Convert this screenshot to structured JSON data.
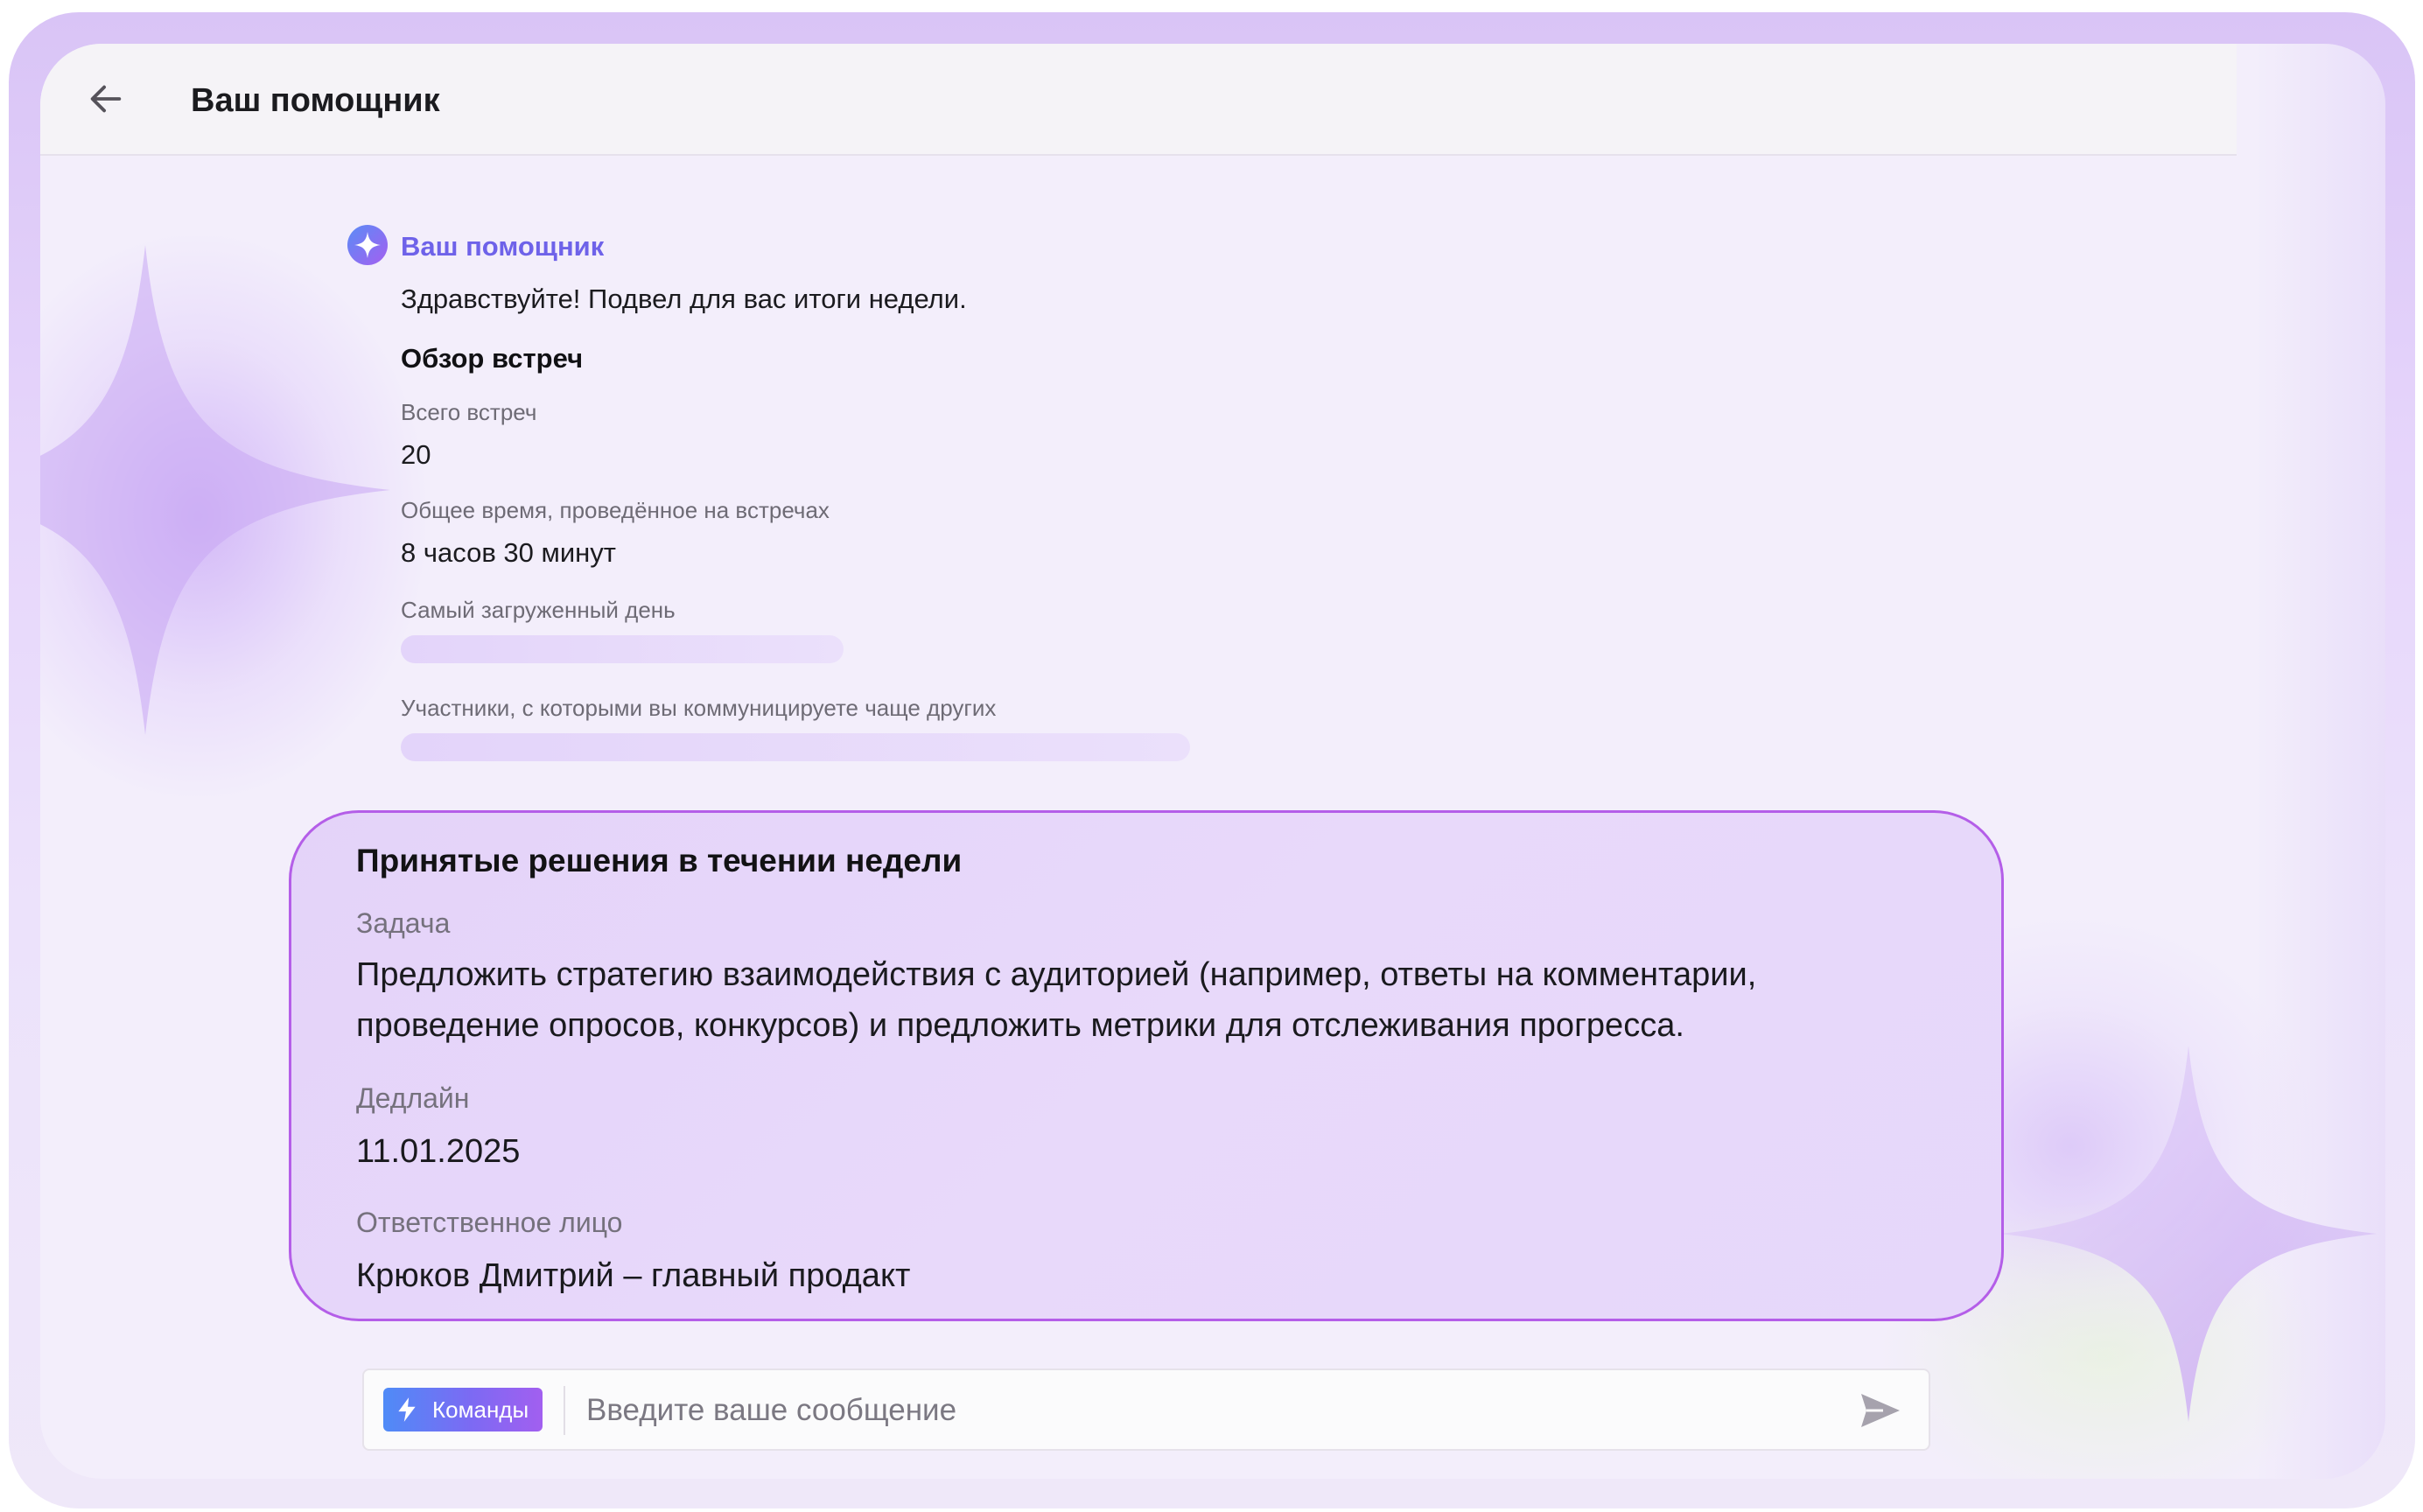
{
  "header": {
    "title": "Ваш помощник",
    "back_icon": "arrow-left-icon"
  },
  "assistant": {
    "icon": "sparkle-icon",
    "name": "Ваш помощник",
    "greeting": "Здравствуйте! Подвел для вас итоги недели.",
    "overview_title": "Обзор встреч",
    "total_meetings_label": "Всего встреч",
    "total_meetings_value": "20",
    "total_time_label": "Общее время, проведённое на встречах",
    "total_time_value": "8 часов 30 минут",
    "busiest_day_label": "Самый загруженный день",
    "frequent_participants_label": "Участники, с которыми вы коммуницируете чаще других"
  },
  "decision_card": {
    "title": "Принятые решения в течении недели",
    "task_label": "Задача",
    "task_value": "Предложить стратегию взаимодействия с аудиторией (например, ответы на комментарии, проведение опросов, конкурсов) и предложить метрики для отслеживания прогресса.",
    "deadline_label": "Дедлайн",
    "deadline_value": "11.01.2025",
    "responsible_label": "Ответственное лицо",
    "responsible_value": "Крюков Дмитрий – главный продакт"
  },
  "composer": {
    "commands_label": "Команды",
    "commands_icon": "lightning-icon",
    "placeholder": "Введите ваше сообщение",
    "send_icon": "send-icon"
  },
  "colors": {
    "accent": "#b45ee8",
    "assistant_name": "#6e62e9",
    "card_background": "#e6d7fa",
    "frame": "#d9c4f6"
  }
}
